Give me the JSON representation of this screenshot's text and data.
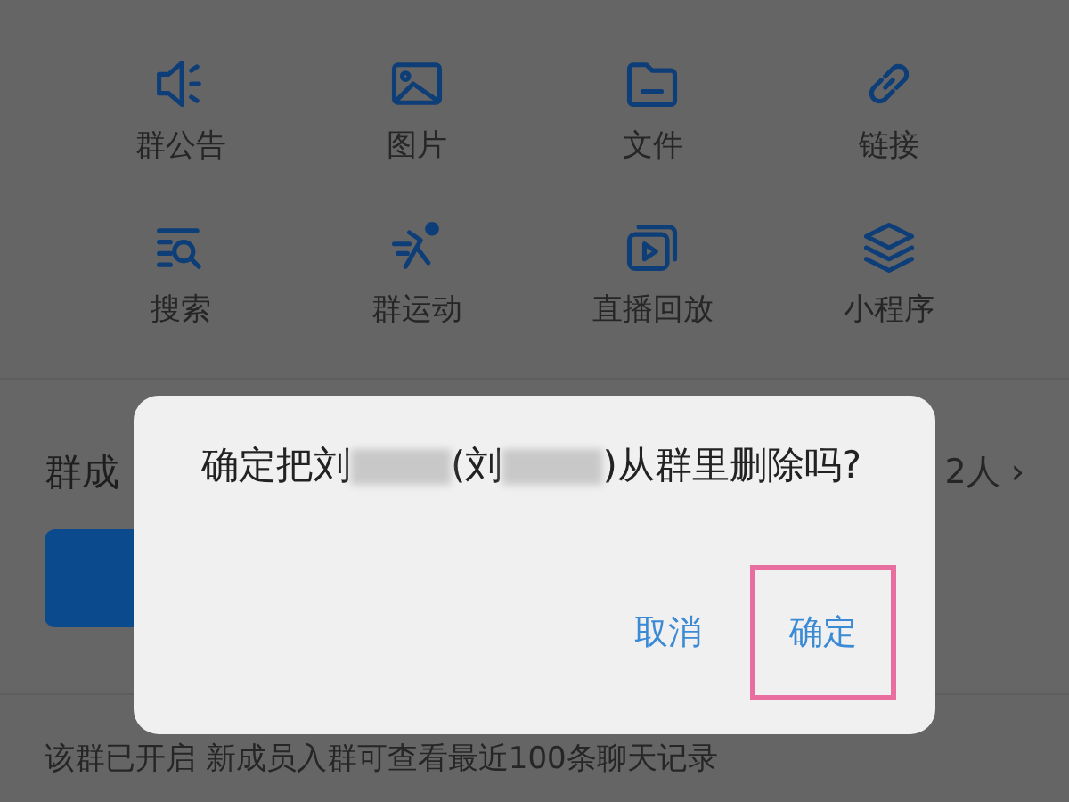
{
  "features": [
    {
      "label": "群公告",
      "kind": "speaker"
    },
    {
      "label": "图片",
      "kind": "image"
    },
    {
      "label": "文件",
      "kind": "folder"
    },
    {
      "label": "链接",
      "kind": "link"
    },
    {
      "label": "搜索",
      "kind": "search"
    },
    {
      "label": "群运动",
      "kind": "runner"
    },
    {
      "label": "直播回放",
      "kind": "video"
    },
    {
      "label": "小程序",
      "kind": "layers"
    }
  ],
  "members": {
    "title": "群成",
    "count": "2人",
    "chevron": "›",
    "tiles": [
      {
        "kind": "avatar"
      }
    ]
  },
  "notice": "该群已开启 新成员入群可查看最近100条聊天记录",
  "dialog": {
    "message": [
      {
        "kind": "text",
        "text": "确定把刘"
      },
      {
        "kind": "redacted"
      },
      {
        "kind": "text",
        "text": "(刘"
      },
      {
        "kind": "redacted"
      },
      {
        "kind": "text",
        "text": ")从群里删除吗?"
      }
    ],
    "buttons": [
      {
        "label": "取消",
        "highlighted": false
      },
      {
        "label": "确定",
        "highlighted": true
      }
    ]
  }
}
